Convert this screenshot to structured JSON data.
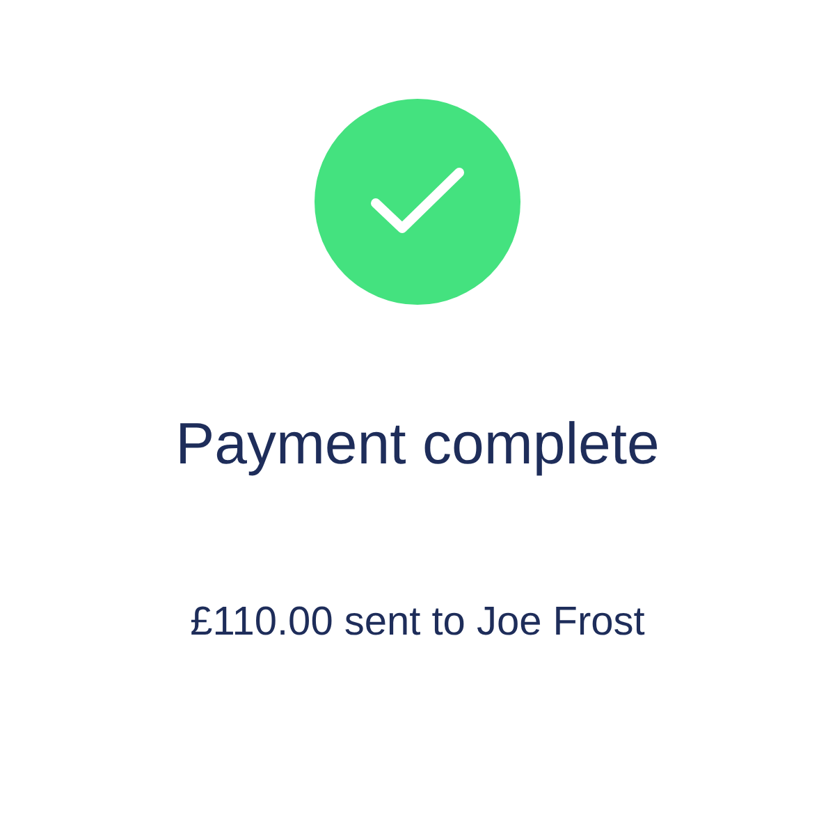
{
  "status": {
    "kind": "success"
  },
  "title": "Payment complete",
  "message": "£110.00 sent to Joe Frost"
}
